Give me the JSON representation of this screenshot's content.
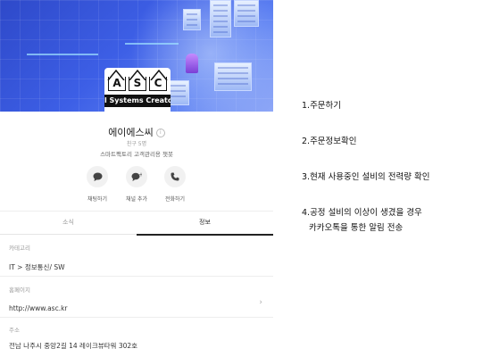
{
  "profile": {
    "logo": {
      "letters": [
        "A",
        "S",
        "C"
      ],
      "subtitle": "l Systems Creator"
    },
    "name": "에이에스씨",
    "friends": "친구 5명",
    "description": "스마트팩토리 고객관리용 챗봇",
    "actions": [
      {
        "label": "채팅하기",
        "icon": "chat-icon"
      },
      {
        "label": "채널 추가",
        "icon": "add-channel-icon"
      },
      {
        "label": "전화하기",
        "icon": "phone-icon"
      }
    ],
    "tabs": {
      "news": "소식",
      "info": "정보"
    },
    "category": {
      "caption": "카테고리",
      "value": "IT > 정보통신/ SW"
    },
    "homepage": {
      "caption": "홈페이지",
      "value": "http://www.asc.kr"
    },
    "address": {
      "caption": "주소",
      "value": "전남 나주시 중앙2길 14 레이크뷰타워 302호"
    }
  },
  "steps": [
    "1.주문하기",
    "2.주문정보확인",
    "3.현재 사용중인 설비의 전력량 확인",
    "4.공정 설비의 이상이 생겼을 경우",
    "카카오톡을 통한 알림 전송"
  ],
  "colors": {
    "banner": "#3d5fe6",
    "text": "#111111",
    "muted": "#999999"
  }
}
